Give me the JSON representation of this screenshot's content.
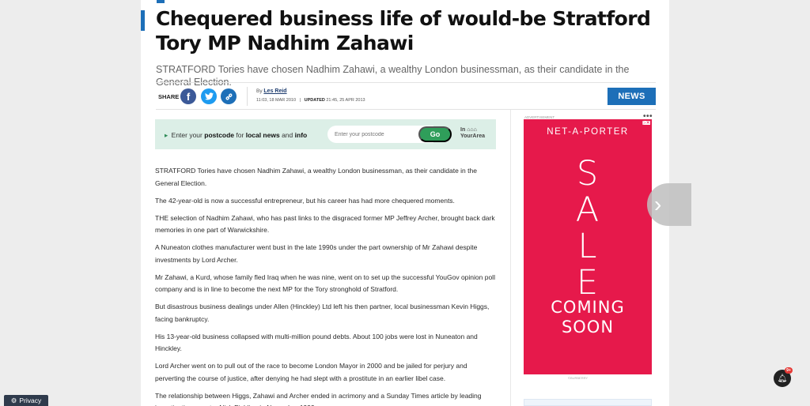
{
  "article": {
    "headline": "Chequered business life of would-be Stratford Tory MP Nadhim Zahawi",
    "standfirst": "STRATFORD Tories have chosen Nadhim Zahawi, a wealthy London businessman, as their candidate in the General Election.",
    "share_label": "SHARE",
    "byline_prefix": "By",
    "author": "Les Reid",
    "published": "11:03, 18 MAR 2010",
    "updated_label": "UPDATED",
    "updated": "21:45, 25 APR 2013",
    "section_tag": "NEWS",
    "paragraphs": [
      "STRATFORD Tories have chosen Nadhim Zahawi, a wealthy London businessman, as their candidate in the General Election.",
      "The 42-year-old is now a successful entrepreneur, but his career has had more chequered moments.",
      "THE selection of Nadhim Zahawi, who has past links to the disgraced former MP Jeffrey Archer, brought back dark memories in one part of Warwickshire.",
      "A Nuneaton clothes manufacturer went bust in the late 1990s under the part ownership of Mr Zahawi despite investments by Lord Archer.",
      "Mr Zahawi, a Kurd, whose family fled Iraq when he was nine, went on to set up the successful YouGov opinion poll company and is in line to become the next MP for the Tory stronghold of Stratford.",
      "But disastrous business dealings under Allen (Hinckley) Ltd left his then partner, local businessman Kevin Higgs, facing bankruptcy.",
      "His 13-year-old business collapsed with multi-million pound debts. About 100 jobs were lost in Nuneaton and Hinckley.",
      "Lord Archer went on to pull out of the race to become London Mayor in 2000 and be jailed for perjury and perverting the course of justice, after denying he had slept with a prostitute in an earlier libel case.",
      "The relationship between Higgs, Zahawi and Archer ended in acrimony and a Sunday Times article by leading investigative reporter Nick Fielding in November 1999"
    ]
  },
  "postcode_widget": {
    "text_prefix": "Enter your",
    "text_bold1": "postcode",
    "text_mid": "for",
    "text_bold2": "local news",
    "text_and": "and",
    "text_bold3": "info",
    "placeholder": "Enter your postcode",
    "button": "Go",
    "brand_line1": "In",
    "brand_line2": "YourArea"
  },
  "advert": {
    "label": "ADVERTISEMENT",
    "brand": "NET-A-PORTER",
    "sale_letters": [
      "S",
      "A",
      "L",
      "E"
    ],
    "coming": "COMING",
    "soon": "SOON",
    "credit": "©BURBERRY",
    "color": "#e6194b"
  },
  "ui": {
    "privacy_label": "Privacy",
    "notification_count": "9+",
    "accent": "#1d6fb8"
  }
}
